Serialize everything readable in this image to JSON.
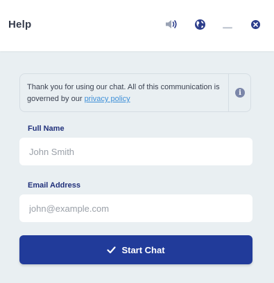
{
  "header": {
    "title": "Help",
    "icons": [
      "volume-icon",
      "globe-icon",
      "minimize-icon",
      "close-icon"
    ]
  },
  "notice": {
    "text": "Thank you for using our chat. All of this communication is governed by our ",
    "link_text": "privacy policy",
    "icon": "info-icon"
  },
  "form": {
    "full_name": {
      "label": "Full Name",
      "placeholder": "John Smith",
      "value": ""
    },
    "email": {
      "label": "Email Address",
      "placeholder": "john@example.com",
      "value": ""
    },
    "submit_label": "Start Chat",
    "submit_icon": "check-icon"
  },
  "colors": {
    "accent": "#213b9a",
    "label": "#1f2f7a",
    "link": "#3d8fd8",
    "background": "#e9eff2"
  }
}
